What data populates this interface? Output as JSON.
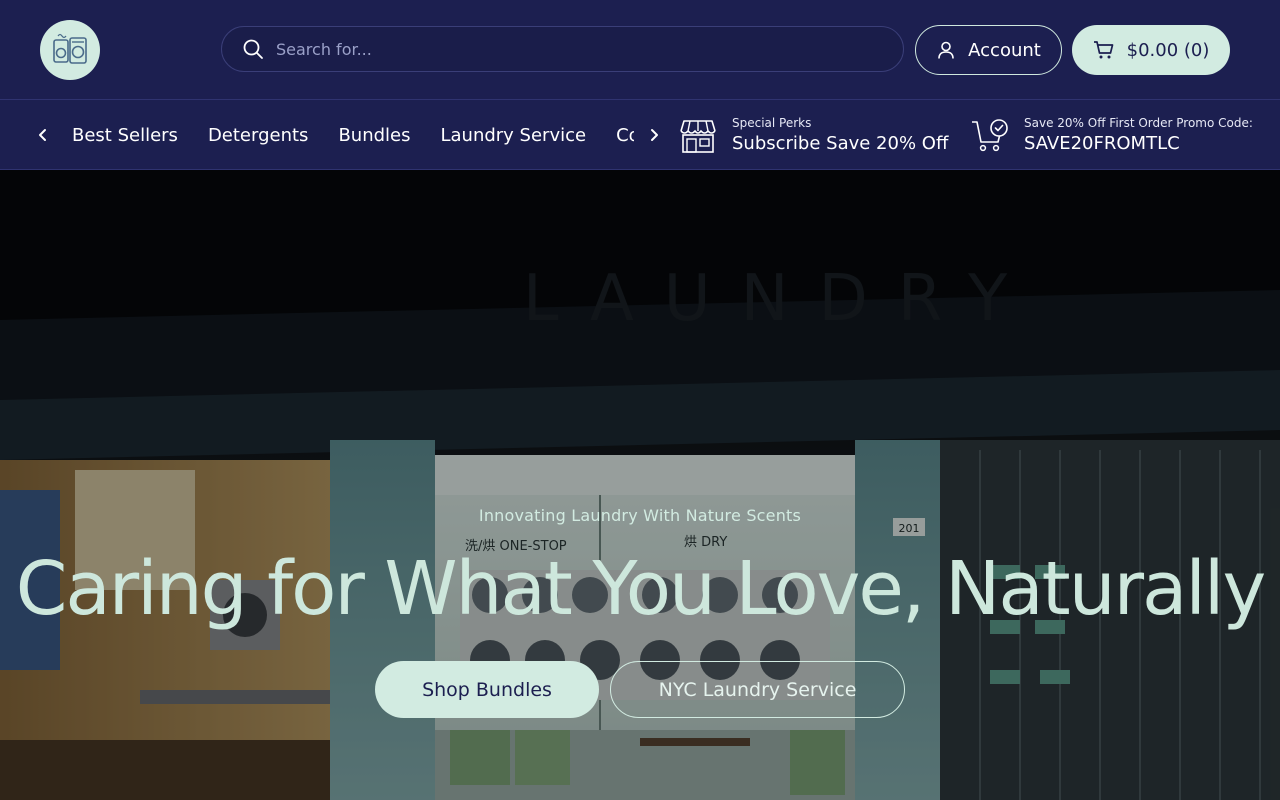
{
  "header": {
    "logo_icon": "laundry-machine-logo-icon",
    "search": {
      "placeholder": "Search for...",
      "value": ""
    },
    "account_label": "Account",
    "cart_label": "$0.00 (0)"
  },
  "nav": {
    "items": [
      {
        "label": "Best Sellers"
      },
      {
        "label": "Detergents"
      },
      {
        "label": "Bundles"
      },
      {
        "label": "Laundry Service"
      },
      {
        "label": "Contact"
      }
    ],
    "perks": [
      {
        "icon": "storefront-icon",
        "small": "Special Perks",
        "big": "Subscribe Save 20% Off"
      },
      {
        "icon": "cart-check-icon",
        "small": "Save 20% Off First Order Promo Code:",
        "big": "SAVE20FROMTLC"
      }
    ]
  },
  "hero": {
    "eyebrow": "Innovating Laundry With Nature Scents",
    "headline": "Caring for What You Love, Naturally",
    "primary_button": "Shop Bundles",
    "secondary_button": "NYC Laundry Service",
    "scene_signs": {
      "storefront": "LAUNDRY",
      "wash_dry": "洗/烘 ONE-STOP",
      "dry": "烘 DRY",
      "unit": "201"
    }
  },
  "colors": {
    "navy": "#1c1f50",
    "mint": "#d2ebe1",
    "headline": "#cde7dc"
  }
}
